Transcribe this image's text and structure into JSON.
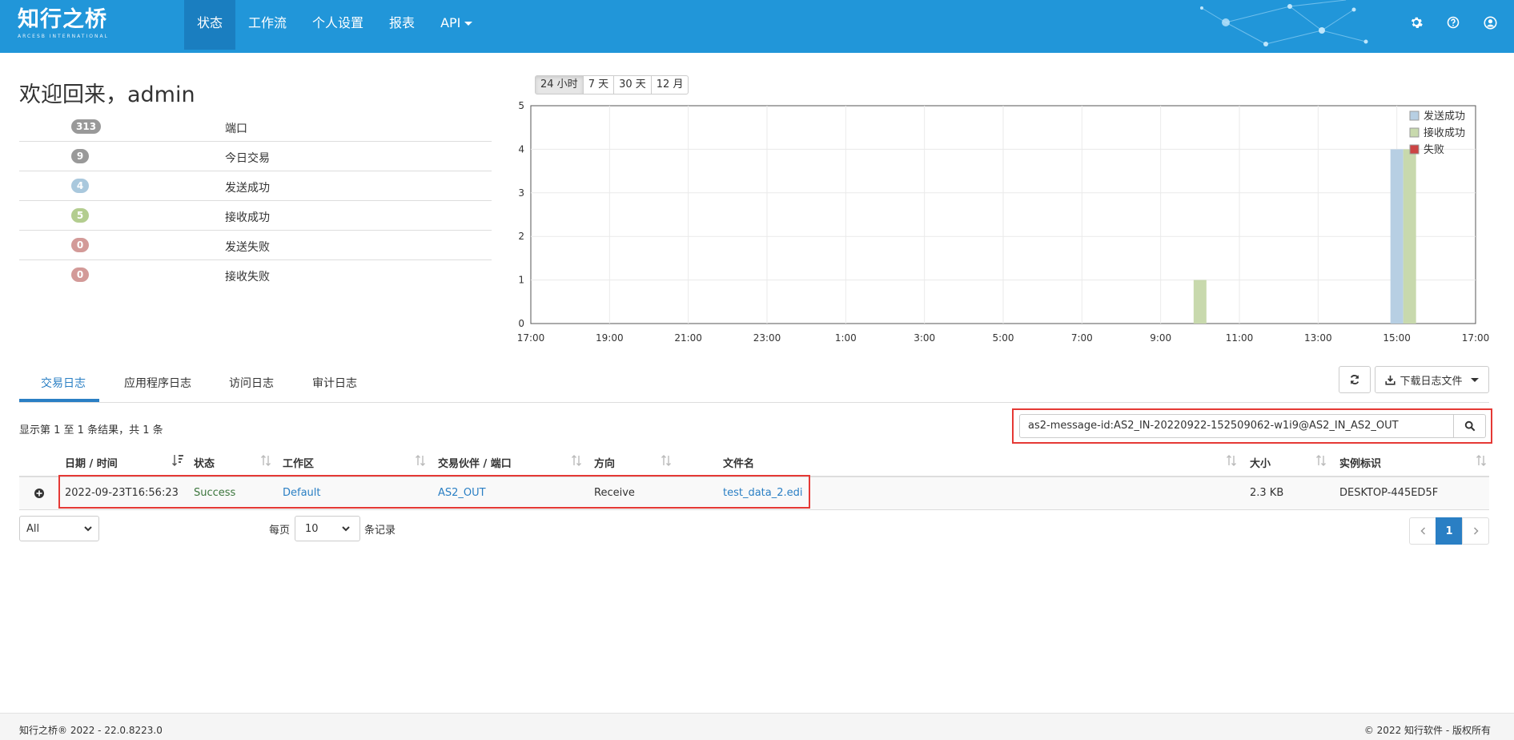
{
  "brand": {
    "name": "知行之桥",
    "subtitle": "ARCESB INTERNATIONAL"
  },
  "nav": {
    "items": [
      {
        "label": "状态",
        "active": true
      },
      {
        "label": "工作流"
      },
      {
        "label": "个人设置"
      },
      {
        "label": "报表"
      },
      {
        "label": "API"
      }
    ],
    "icons": [
      "gear-icon",
      "help-icon",
      "user-icon"
    ]
  },
  "welcome": "欢迎回来，admin",
  "stats": [
    {
      "count": "313",
      "label": "端口",
      "color": "#999999"
    },
    {
      "count": "9",
      "label": "今日交易",
      "color": "#999999"
    },
    {
      "count": "4",
      "label": "发送成功",
      "color": "#a9c8dd"
    },
    {
      "count": "5",
      "label": "接收成功",
      "color": "#b3cd8f"
    },
    {
      "count": "0",
      "label": "发送失败",
      "color": "#d39a98"
    },
    {
      "count": "0",
      "label": "接收失败",
      "color": "#d39a98"
    }
  ],
  "range_buttons": [
    "24 小时",
    "7 天",
    "30 天",
    "12 月"
  ],
  "chart_data": {
    "type": "bar",
    "x_tick_labels": [
      "17:00",
      "19:00",
      "21:00",
      "23:00",
      "1:00",
      "3:00",
      "5:00",
      "7:00",
      "9:00",
      "11:00",
      "13:00",
      "15:00",
      "17:00"
    ],
    "ylim": [
      0,
      5
    ],
    "y_ticks": [
      0,
      1,
      2,
      3,
      4,
      5
    ],
    "grid": true,
    "legend_position": "top-right",
    "series": [
      {
        "name": "发送成功",
        "color": "#b7cfe3",
        "points": [
          {
            "x": "15:00",
            "y": 4
          }
        ]
      },
      {
        "name": "接收成功",
        "color": "#c8d9ad",
        "points": [
          {
            "x": "10:00",
            "y": 1
          },
          {
            "x": "15:00",
            "y": 4
          }
        ]
      },
      {
        "name": "失败",
        "color": "#cc4444",
        "points": []
      }
    ]
  },
  "tabs": [
    "交易日志",
    "应用程序日志",
    "访问日志",
    "审计日志"
  ],
  "toolbar": {
    "download_label": "下载日志文件"
  },
  "result_info": "显示第 1 至 1 条结果，共 1 条",
  "search": {
    "value": "as2-message-id:AS2_IN-20220922-152509062-w1i9@AS2_IN_AS2_OUT"
  },
  "table": {
    "columns": [
      "日期 / 时间",
      "状态",
      "工作区",
      "交易伙伴 / 端口",
      "方向",
      "文件名",
      "大小",
      "实例标识"
    ],
    "rows": [
      [
        "2022-09-23T16:56:23",
        "Success",
        "Default",
        "AS2_OUT",
        "Receive",
        "test_data_2.edi",
        "2.3 KB",
        "DESKTOP-445ED5F"
      ]
    ]
  },
  "filter": {
    "selected": "All"
  },
  "per_page": {
    "label": "每页",
    "value": "10",
    "suffix": "条记录"
  },
  "pagination": {
    "current": "1"
  },
  "footer": {
    "left": "知行之桥® 2022 - 22.0.8223.0",
    "right": "© 2022 知行软件 - 版权所有"
  }
}
